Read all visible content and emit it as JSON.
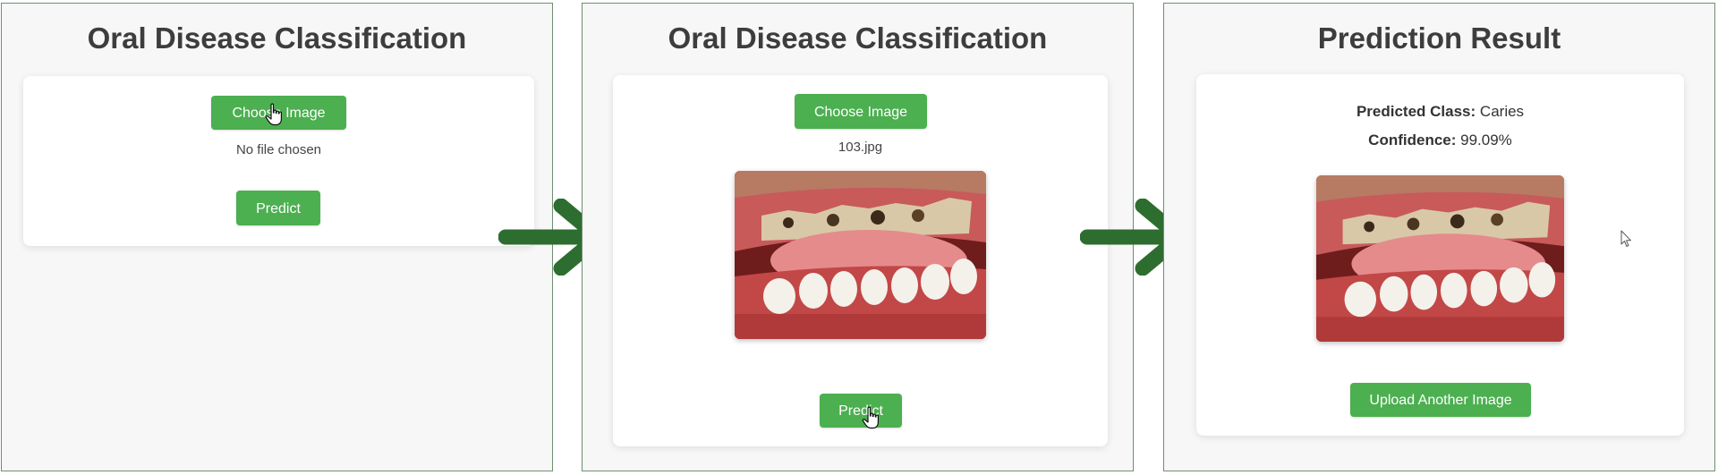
{
  "panel1": {
    "title": "Oral Disease Classification",
    "choose_label": "Choose Image",
    "file_status": "No file chosen",
    "predict_label": "Predict"
  },
  "panel2": {
    "title": "Oral Disease Classification",
    "choose_label": "Choose Image",
    "file_name": "103.jpg",
    "image_alt": "uploaded oral photo",
    "predict_label": "Predict"
  },
  "panel3": {
    "title": "Prediction Result",
    "class_label": "Predicted Class:",
    "class_value": "Caries",
    "confidence_label": "Confidence:",
    "confidence_value": "99.09%",
    "upload_another_label": "Upload Another Image"
  },
  "colors": {
    "button": "#4caf50",
    "arrow": "#2d6e30",
    "title": "#3d3d3d",
    "panel_bg": "#f6f7f6",
    "panel_border": "#6f8f71"
  },
  "icons": {
    "arrow": "right-arrow-icon",
    "pointer": "hand-pointer-icon",
    "cursor": "mouse-cursor-icon"
  }
}
